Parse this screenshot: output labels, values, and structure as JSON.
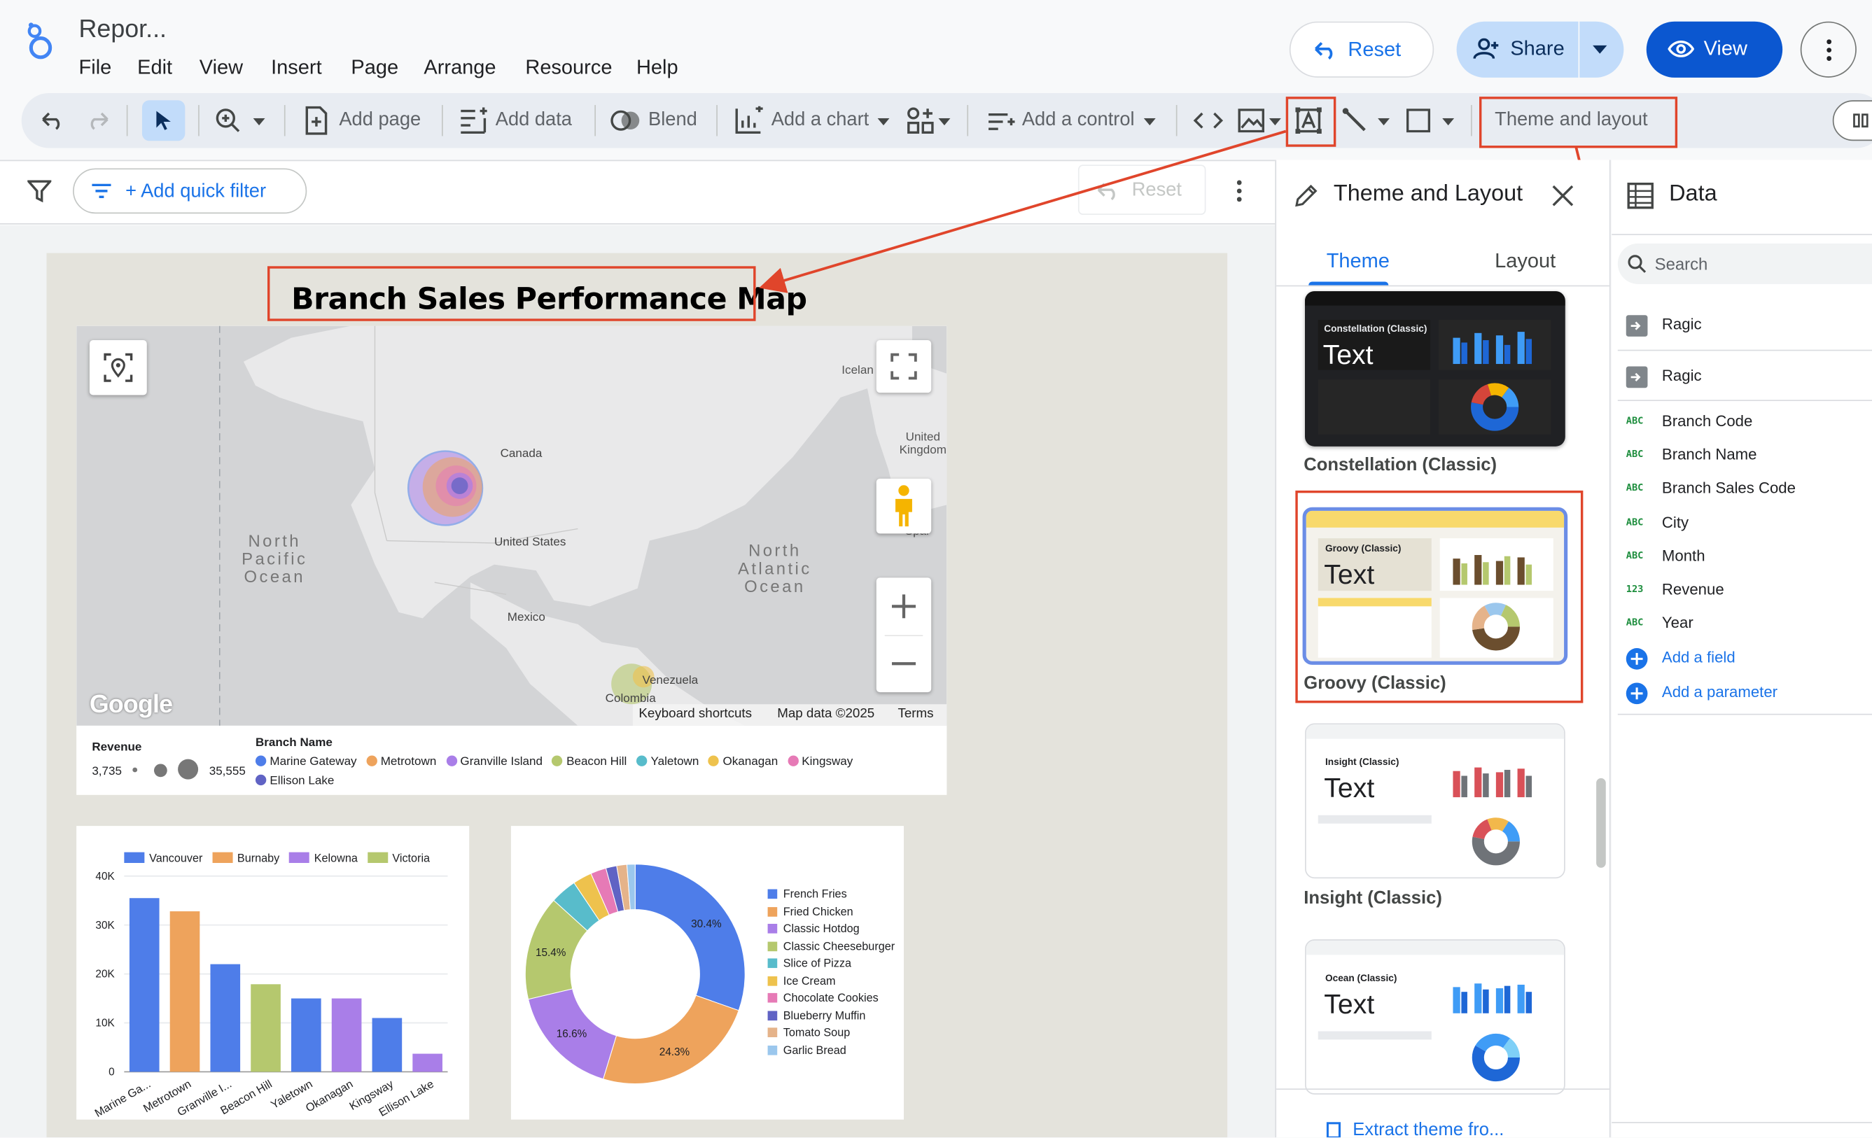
{
  "app": {
    "title": "Repor...",
    "menu": [
      "File",
      "Edit",
      "View",
      "Insert",
      "Page",
      "Arrange",
      "Resource",
      "Help"
    ]
  },
  "header": {
    "reset_label": "Reset",
    "share_label": "Share",
    "view_label": "View"
  },
  "toolbar": {
    "add_page": "Add page",
    "add_data": "Add data",
    "blend": "Blend",
    "add_chart": "Add a chart",
    "add_control": "Add a control",
    "theme_layout": "Theme and layout"
  },
  "filterbar": {
    "add_quick_filter": "+ Add quick filter",
    "reset_label": "Reset"
  },
  "report": {
    "title": "Branch Sales Performance Map",
    "map": {
      "labels": {
        "iceland": "Icelan",
        "uk": "United Kingdom",
        "canada": "Canada",
        "us": "United States",
        "mexico": "Mexico",
        "north_pacific": "North Pacific Ocean",
        "north_atlantic": "North Atlantic Ocean",
        "venezuela": "Venezuela",
        "colombia": "Colombia",
        "spain": "Spain"
      },
      "google": "Google",
      "footer": [
        "Keyboard shortcuts",
        "Map data ©2025",
        "Terms"
      ]
    },
    "map_legend": {
      "revenue_title": "Revenue",
      "revenue_min": "3,735",
      "revenue_max": "35,555",
      "branch_title": "Branch Name",
      "branches": [
        {
          "name": "Marine Gateway",
          "color": "#4e7de9"
        },
        {
          "name": "Metrotown",
          "color": "#eea35c"
        },
        {
          "name": "Granville Island",
          "color": "#a97ee8"
        },
        {
          "name": "Beacon Hill",
          "color": "#b5c86e"
        },
        {
          "name": "Yaletown",
          "color": "#58bccb"
        },
        {
          "name": "Okanagan",
          "color": "#eec24d"
        },
        {
          "name": "Kingsway",
          "color": "#e67ab6"
        },
        {
          "name": "Ellison Lake",
          "color": "#6063c4"
        }
      ]
    }
  },
  "chart_data": [
    {
      "type": "bar",
      "title": "",
      "categories": [
        "Marine Ga...",
        "Metrotown",
        "Granville I...",
        "Beacon Hill",
        "Yaletown",
        "Okanagan",
        "Kingsway",
        "Ellison Lake"
      ],
      "series": [
        {
          "name": "Vancouver",
          "color": "#4e7de9",
          "values": [
            35500,
            0,
            22000,
            0,
            15000,
            0,
            11000,
            0
          ]
        },
        {
          "name": "Burnaby",
          "color": "#eea35c",
          "values": [
            0,
            32800,
            0,
            0,
            0,
            0,
            0,
            0
          ]
        },
        {
          "name": "Kelowna",
          "color": "#a97ee8",
          "values": [
            0,
            0,
            0,
            0,
            0,
            15000,
            0,
            3700
          ]
        },
        {
          "name": "Victoria",
          "color": "#b5c86e",
          "values": [
            0,
            0,
            0,
            17900,
            0,
            0,
            0,
            0
          ]
        }
      ],
      "yticks": [
        "40K",
        "30K",
        "20K",
        "10K",
        "0"
      ],
      "ylim": [
        0,
        40000
      ],
      "grid": true,
      "legend": "top"
    },
    {
      "type": "pie",
      "title": "",
      "labels": [
        "French Fries",
        "Fried Chicken",
        "Classic Hotdog",
        "Classic Cheeseburger",
        "Slice of Pizza",
        "Ice Cream",
        "Chocolate Cookies",
        "Blueberry Muffin",
        "Tomato Soup",
        "Garlic Bread"
      ],
      "values": [
        30.4,
        24.3,
        16.6,
        15.4,
        3.9,
        2.8,
        2.3,
        1.6,
        1.5,
        1.2
      ],
      "value_labels": [
        "30.4%",
        "24.3%",
        "16.6%",
        "15.4%",
        "",
        "",
        "",
        "",
        "",
        ""
      ],
      "colors": [
        "#4e7de9",
        "#eea35c",
        "#a97ee8",
        "#b5c86e",
        "#58bccb",
        "#eec24d",
        "#e67ab6",
        "#6063c4",
        "#e5b38a",
        "#9bc7ed"
      ],
      "donut": true,
      "legend": "right"
    }
  ],
  "theme_panel": {
    "title": "Theme and Layout",
    "tabs": [
      "Theme",
      "Layout"
    ],
    "themes": [
      {
        "name": "Constellation (Classic)",
        "thumb_label": "Constellation (Classic)",
        "thumb_text": "Text"
      },
      {
        "name": "Groovy (Classic)",
        "thumb_label": "Groovy (Classic)",
        "thumb_text": "Text"
      },
      {
        "name": "Insight (Classic)",
        "thumb_label": "Insight (Classic)",
        "thumb_text": "Text"
      },
      {
        "name": "Ocean (Classic)",
        "thumb_label": "Ocean (Classic)",
        "thumb_text": "Text"
      }
    ],
    "extract_label": "Extract theme fro..."
  },
  "data_panel": {
    "title": "Data",
    "search_placeholder": "Search",
    "sources": [
      "Ragic",
      "Ragic"
    ],
    "fields": [
      {
        "type": "ABC",
        "name": "Branch Code"
      },
      {
        "type": "ABC",
        "name": "Branch Name"
      },
      {
        "type": "ABC",
        "name": "Branch Sales Code"
      },
      {
        "type": "ABC",
        "name": "City"
      },
      {
        "type": "ABC",
        "name": "Month"
      },
      {
        "type": "123",
        "name": "Revenue"
      },
      {
        "type": "ABC",
        "name": "Year"
      }
    ],
    "add_field": "Add a field",
    "add_parameter": "Add a parameter"
  }
}
